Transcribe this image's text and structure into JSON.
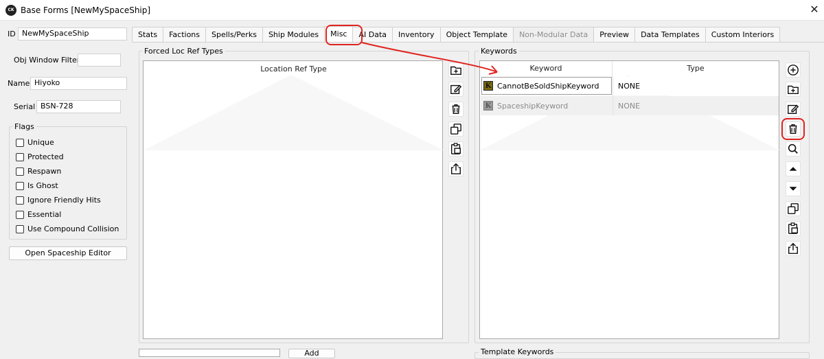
{
  "window": {
    "app_icon_text": "CK",
    "title": "Base Forms [NewMySpaceShip]",
    "close_glyph": "✕"
  },
  "left_panel": {
    "id_label": "ID",
    "id_value": "NewMySpaceShip",
    "obj_filter_label": "Obj Window Filter",
    "obj_filter_value": "",
    "name_label": "Name",
    "name_value": "Hiyoko",
    "serial_label": "Serial",
    "serial_value": "BSN-728",
    "flags_title": "Flags",
    "flags": [
      {
        "label": "Unique",
        "checked": false
      },
      {
        "label": "Protected",
        "checked": false
      },
      {
        "label": "Respawn",
        "checked": false
      },
      {
        "label": "Is Ghost",
        "checked": false
      },
      {
        "label": "Ignore Friendly Hits",
        "checked": false
      },
      {
        "label": "Essential",
        "checked": false
      },
      {
        "label": "Use Compound Collision",
        "checked": false
      }
    ],
    "open_editor_button": "Open Spaceship Editor"
  },
  "tabs": [
    {
      "label": "Stats",
      "state": "normal"
    },
    {
      "label": "Factions",
      "state": "normal"
    },
    {
      "label": "Spells/Perks",
      "state": "normal"
    },
    {
      "label": "Ship Modules",
      "state": "normal"
    },
    {
      "label": "Misc",
      "state": "active"
    },
    {
      "label": "AI Data",
      "state": "normal"
    },
    {
      "label": "Inventory",
      "state": "normal"
    },
    {
      "label": "Object Template",
      "state": "normal"
    },
    {
      "label": "Non-Modular Data",
      "state": "disabled"
    },
    {
      "label": "Preview",
      "state": "normal"
    },
    {
      "label": "Data Templates",
      "state": "normal"
    },
    {
      "label": "Custom Interiors",
      "state": "normal"
    }
  ],
  "forced_loc": {
    "title": "Forced Loc Ref Types",
    "column": "Location Ref Type"
  },
  "keywords": {
    "title": "Keywords",
    "columns": [
      "Keyword",
      "Type"
    ],
    "rows": [
      {
        "badge": "K",
        "keyword": "CannotBeSoldShipKeyword",
        "type": "NONE",
        "dimmed": false,
        "selected": true
      },
      {
        "badge": "K",
        "keyword": "SpaceshipKeyword",
        "type": "NONE",
        "dimmed": true,
        "selected": false
      }
    ]
  },
  "bottom": {
    "add_button": "Add",
    "template_keywords_title": "Template Keywords"
  },
  "colors": {
    "annotation_red": "#e0231f",
    "keyword_badge_active": "#7a6a10",
    "keyword_badge_dimmed": "#9a9a9a"
  }
}
